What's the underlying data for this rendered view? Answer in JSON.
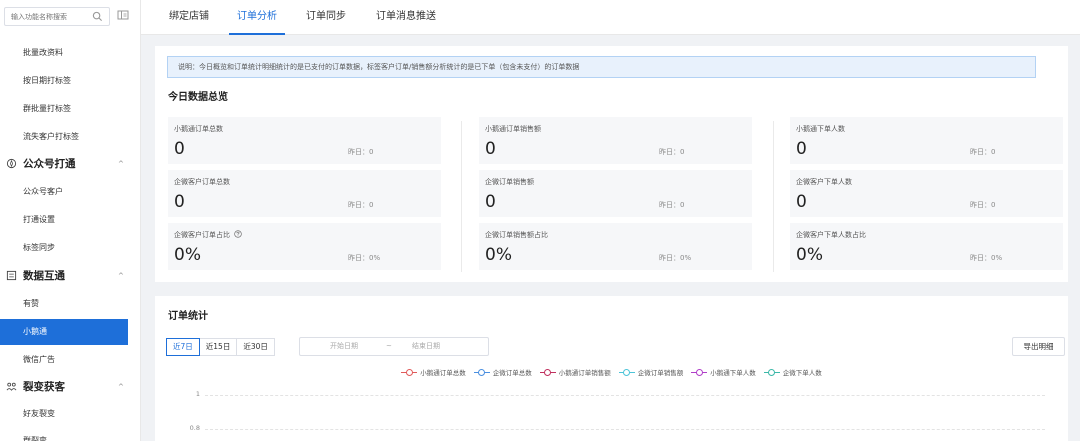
{
  "sidebar": {
    "search_placeholder": "输入功能名称搜索",
    "items": [
      {
        "label": "批量改资料"
      },
      {
        "label": "按日期打标签"
      },
      {
        "label": "群批量打标签"
      },
      {
        "label": "流失客户打标签"
      }
    ],
    "groups": [
      {
        "label": "公众号打通",
        "chevron": "^",
        "icon": "compass-icon",
        "items": [
          "公众号客户",
          "打通设置",
          "标签同步"
        ]
      },
      {
        "label": "数据互通",
        "chevron": "^",
        "icon": "data-exchange-icon",
        "items": [
          "有赞",
          "小鹅通",
          "微信广告"
        ]
      },
      {
        "label": "裂变获客",
        "chevron": "^",
        "icon": "fission-icon",
        "items": [
          "好友裂变",
          "群裂变"
        ]
      }
    ],
    "active_item": "小鹅通",
    "accent_color": "#1e6fd9"
  },
  "tabs": [
    {
      "label": "绑定店铺"
    },
    {
      "label": "订单分析"
    },
    {
      "label": "订单同步"
    },
    {
      "label": "订单消息推送"
    }
  ],
  "active_tab": "订单分析",
  "notice": "说明：今日概览和订单统计明细统计的是已支付的订单数据，标签客户订单/销售额分析统计的是已下单（包含未支付）的订单数据",
  "overview": {
    "title": "今日数据总览",
    "yesterday_prefix": "昨日：",
    "cards": [
      {
        "label": "小鹅通订单总数",
        "value": "0",
        "yesterday": "昨日：0"
      },
      {
        "label": "小鹅通订单销售额",
        "value": "0",
        "yesterday": "昨日：0"
      },
      {
        "label": "小鹅通下单人数",
        "value": "0",
        "yesterday": "昨日：0"
      },
      {
        "label": "企微客户订单总数",
        "value": "0",
        "yesterday": "昨日：0"
      },
      {
        "label": "企微订单销售额",
        "value": "0",
        "yesterday": "昨日：0"
      },
      {
        "label": "企微客户下单人数",
        "value": "0",
        "yesterday": "昨日：0"
      },
      {
        "label": "企微客户订单占比",
        "value": "0%",
        "yesterday": "昨日：0%",
        "has_help": true
      },
      {
        "label": "企微订单销售额占比",
        "value": "0%",
        "yesterday": "昨日：0%"
      },
      {
        "label": "企微客户下单人数占比",
        "value": "0%",
        "yesterday": "昨日：0%"
      }
    ]
  },
  "order_stats": {
    "title": "订单统计",
    "ranges": [
      {
        "label": "近7日"
      },
      {
        "label": "近15日"
      },
      {
        "label": "近30日"
      }
    ],
    "active_range": "近7日",
    "start_placeholder": "开始日期",
    "separator": "~",
    "end_placeholder": "结束日期",
    "export_label": "导出明细"
  },
  "chart_data": {
    "type": "line",
    "title": "",
    "series": [
      {
        "name": "小鹅通订单总数",
        "color": "#e05a5a",
        "values": []
      },
      {
        "name": "企微订单总数",
        "color": "#4a8fe0",
        "values": []
      },
      {
        "name": "小鹅通订单销售额",
        "color": "#c0305e",
        "values": []
      },
      {
        "name": "企微订单销售额",
        "color": "#4cc4d8",
        "values": []
      },
      {
        "name": "小鹅通下单人数",
        "color": "#b03ec8",
        "values": []
      },
      {
        "name": "企微下单人数",
        "color": "#3cb8a8",
        "values": []
      }
    ],
    "y_ticks": [
      "1",
      "0.8"
    ],
    "grid": true,
    "legend": "top-center"
  }
}
